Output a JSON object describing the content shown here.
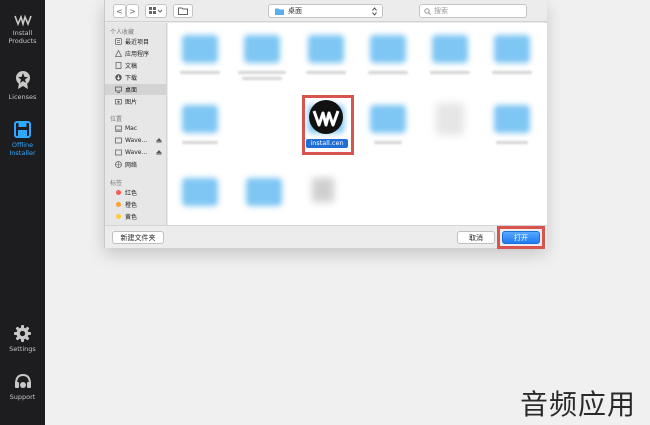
{
  "sidebar": {
    "items": [
      {
        "label": "Install Products",
        "icon": "waves-logo-icon"
      },
      {
        "label": "Licenses",
        "icon": "license-badge-icon"
      },
      {
        "label": "Offline Installer",
        "icon": "save-disk-icon",
        "active": true
      },
      {
        "label": "Settings",
        "icon": "gear-icon"
      },
      {
        "label": "Support",
        "icon": "headset-icon"
      }
    ]
  },
  "dialog": {
    "toolbar": {
      "back": "<",
      "forward": ">",
      "location": "桌面",
      "search_placeholder": "搜索"
    },
    "sidebar": {
      "favorites_header": "个人收藏",
      "favorites": [
        {
          "label": "最近项目",
          "icon": "clock-icon"
        },
        {
          "label": "应用程序",
          "icon": "apps-icon"
        },
        {
          "label": "文稿",
          "icon": "document-icon"
        },
        {
          "label": "下载",
          "icon": "download-icon"
        },
        {
          "label": "桌面",
          "icon": "desktop-icon",
          "selected": true
        },
        {
          "label": "图片",
          "icon": "camera-icon"
        }
      ],
      "locations_header": "位置",
      "locations": [
        {
          "label": "Mac",
          "icon": "computer-icon"
        },
        {
          "label": "Wave...",
          "icon": "drive-icon"
        },
        {
          "label": "Wave...",
          "icon": "drive-icon"
        },
        {
          "label": "网络",
          "icon": "globe-icon"
        }
      ],
      "tags_header": "标签",
      "tags": [
        {
          "label": "红色",
          "color": "#ff5a52"
        },
        {
          "label": "橙色",
          "color": "#ff9f30"
        },
        {
          "label": "黄色",
          "color": "#ffcc33"
        }
      ]
    },
    "selected_file": "install.cen",
    "buttons": {
      "new_folder": "新建文件夹",
      "cancel": "取消",
      "open": "打开"
    }
  },
  "watermark": "音频应用",
  "colors": {
    "accent": "#2fa8ff",
    "highlight": "#d9534f",
    "primary_button": "#1f7cf4"
  }
}
